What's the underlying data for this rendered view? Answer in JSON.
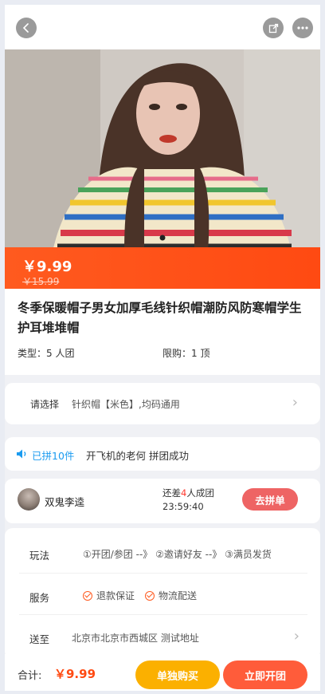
{
  "header": {
    "back_icon": "back-icon",
    "share_icon": "share-icon",
    "more_icon": "more-icon"
  },
  "product": {
    "price_now": "￥9.99",
    "price_old": "￥15.99",
    "title": "冬季保暖帽子男女加厚毛线针织帽潮防风防寒帽学生护耳堆堆帽",
    "type_text": "类型：5 人团",
    "limit_text": "限购：1 顶"
  },
  "option": {
    "label": "请选择",
    "value": "针织帽【米色】,均码通用"
  },
  "grouped": {
    "count_text": "已拼10件",
    "message": "开飞机的老何 拼团成功"
  },
  "group": {
    "user": "双鬼李逵",
    "need_prefix": "还差",
    "need_count": "4",
    "need_suffix": "人成团",
    "timer": "23:59:40",
    "join_label": "去拼单"
  },
  "info": {
    "play_label": "玩法",
    "steps": "①开团/参团  --》 ②邀请好友  --》 ③满员发货",
    "service_label": "服务",
    "service_1": "退款保证",
    "service_2": "物流配送",
    "ship_label": "送至",
    "address": "北京市北京市西城区 测试地址"
  },
  "footer": {
    "total_label": "合计:",
    "total_price": "￥9.99",
    "buy_single": "单独购买",
    "start_group": "立即开团"
  },
  "colors": {
    "accent": "#ff4a12",
    "blue": "#1a9bf0",
    "yellow": "#fbb000",
    "join": "#ee6464"
  }
}
